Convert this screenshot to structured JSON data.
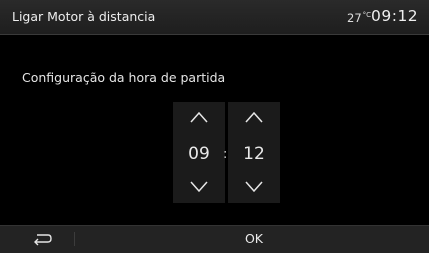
{
  "header": {
    "title": "Ligar Motor à distancia",
    "temperature": "27",
    "temperature_unit": "°C",
    "time": "09:12"
  },
  "main": {
    "label": "Configuração da hora de partida",
    "time_picker": {
      "hours": "09",
      "separator": ":",
      "minutes": "12"
    }
  },
  "footer": {
    "back_icon": "back-arrow-icon",
    "ok_label": "OK"
  },
  "colors": {
    "background": "#000000",
    "header": "#242424",
    "footer": "#232323",
    "picker_column": "#1b1b1b",
    "text": "#e8e8e8"
  }
}
